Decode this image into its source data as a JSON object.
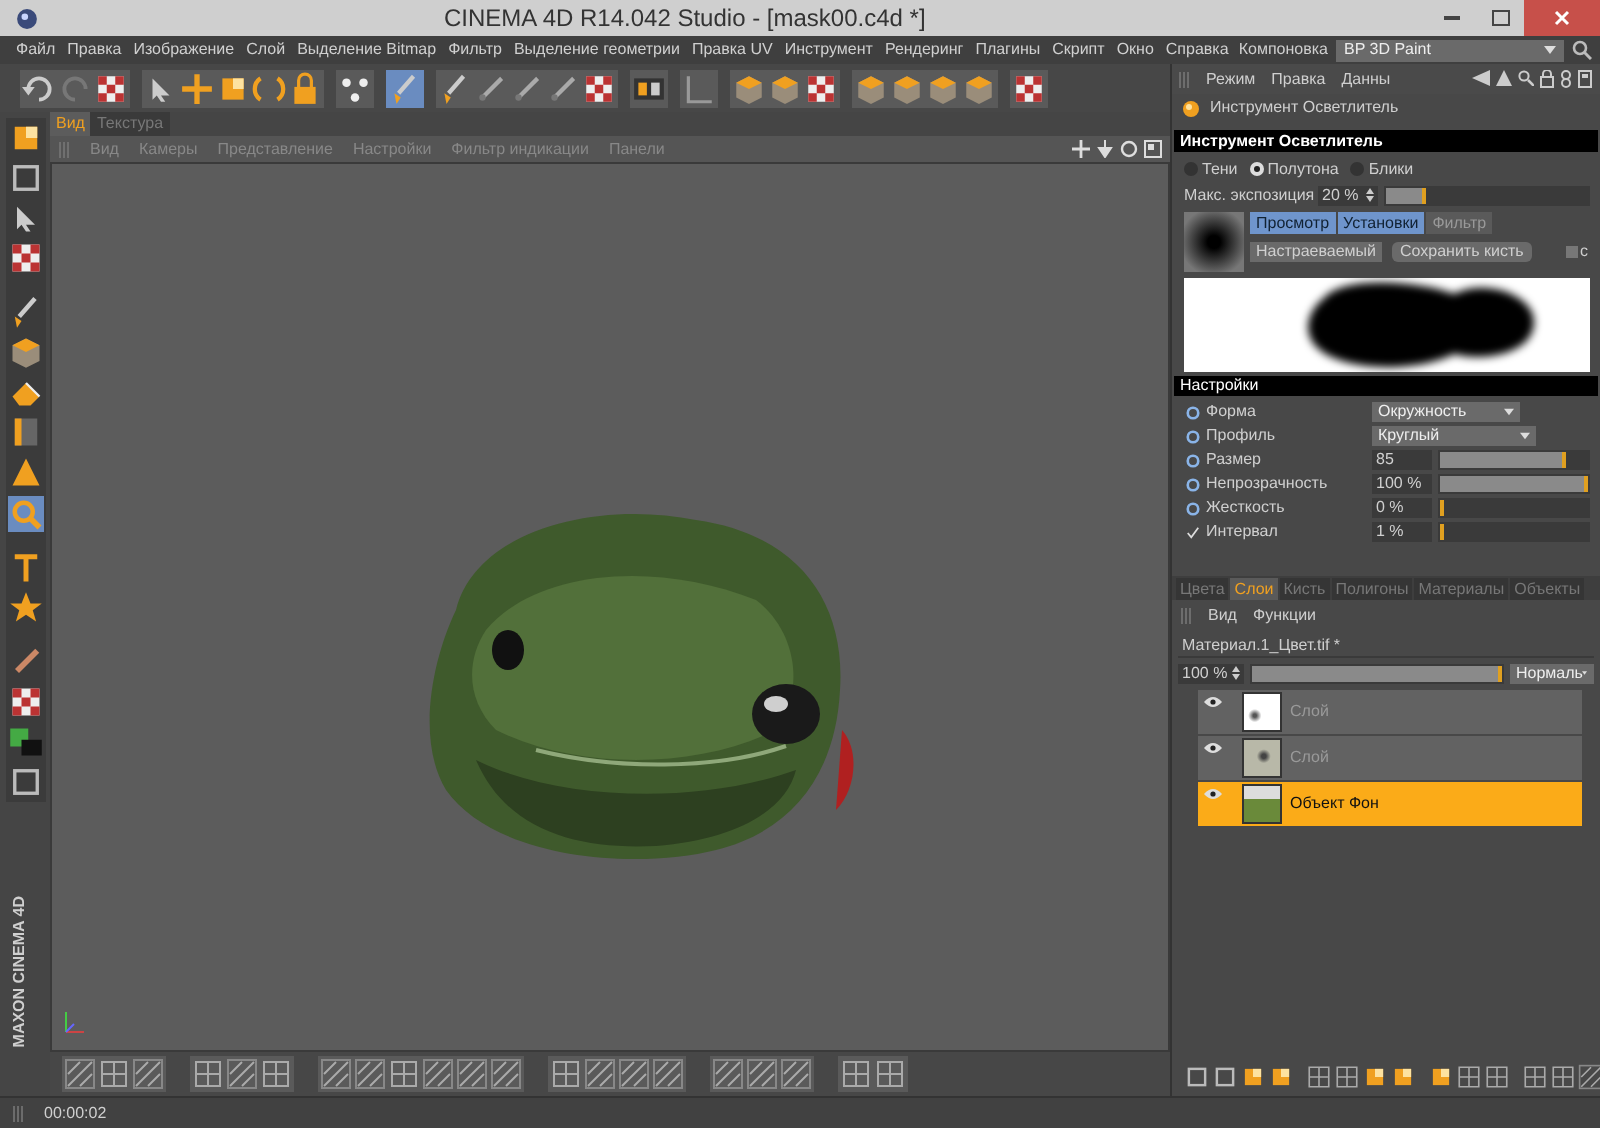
{
  "window": {
    "title": "CINEMA 4D R14.042 Studio - [mask00.c4d *]"
  },
  "menu": [
    "Файл",
    "Правка",
    "Изображение",
    "Слой",
    "Выделение Bitmap",
    "Фильтр",
    "Выделение геометрии",
    "Правка UV",
    "Инструмент",
    "Рендеринг",
    "Плагины",
    "Скрипт",
    "Окно",
    "Справка"
  ],
  "layout": {
    "label": "Компоновка",
    "value": "BP 3D Paint"
  },
  "view_tabs": [
    {
      "label": "Вид",
      "selected": true
    },
    {
      "label": "Текстура",
      "selected": false
    }
  ],
  "view_menu": [
    "Вид",
    "Камеры",
    "Представление",
    "Настройки",
    "Фильтр индикации",
    "Панели"
  ],
  "logo": "MAXON CINEMA 4D",
  "attributes": {
    "menu": [
      "Режим",
      "Правка",
      "Данны"
    ],
    "tool": "Инструмент Осветлитель",
    "header": "Инструмент Осветлитель",
    "ranges": [
      {
        "label": "Тени",
        "selected": false
      },
      {
        "label": "Полутона",
        "selected": true
      },
      {
        "label": "Блики",
        "selected": false
      }
    ],
    "max_exposure": {
      "label": "Макс. экспозиция",
      "value": "20 %",
      "level": 0.2
    },
    "brush_tabs": [
      {
        "label": "Просмотр",
        "selected": true
      },
      {
        "label": "Установки",
        "selected": true
      },
      {
        "label": "Фильтр",
        "selected": false
      }
    ],
    "preset": "Настраеваемый",
    "save_button": "Сохранить кисть",
    "checkbox": {
      "label": "c",
      "checked": false
    },
    "settings_header": "Настройки",
    "settings": [
      {
        "kind": "dropdown",
        "label": "Форма",
        "value": "Окружность"
      },
      {
        "kind": "dropdown",
        "label": "Профиль",
        "value": "Круглый"
      },
      {
        "kind": "slider",
        "label": "Размер",
        "value": "85",
        "level": 0.85
      },
      {
        "kind": "slider",
        "label": "Непрозрачность",
        "value": "100 %",
        "level": 1
      },
      {
        "kind": "slider",
        "label": "Жесткость",
        "value": "0 %",
        "level": 0
      },
      {
        "kind": "slider",
        "label": "Интервал",
        "value": "1 %",
        "level": 0.01,
        "checked": true
      }
    ]
  },
  "layers_panel": {
    "tabs": [
      {
        "label": "Цвета",
        "selected": false
      },
      {
        "label": "Слои",
        "selected": true
      },
      {
        "label": "Кисть",
        "selected": false
      },
      {
        "label": "Полигоны",
        "selected": false
      },
      {
        "label": "Материалы",
        "selected": false
      },
      {
        "label": "Объекты",
        "selected": false
      }
    ],
    "menu": [
      "Вид",
      "Функции"
    ],
    "file": "Материал.1_Цвет.tif *",
    "opacity": {
      "value": "100 %",
      "level": 1
    },
    "blend": "Нормаль",
    "layers": [
      {
        "name": "Слой",
        "selected": false
      },
      {
        "name": "Слой",
        "selected": false
      },
      {
        "name": "Объект Фон",
        "selected": true
      }
    ]
  },
  "status_bar": {
    "time": "00:00:02"
  }
}
